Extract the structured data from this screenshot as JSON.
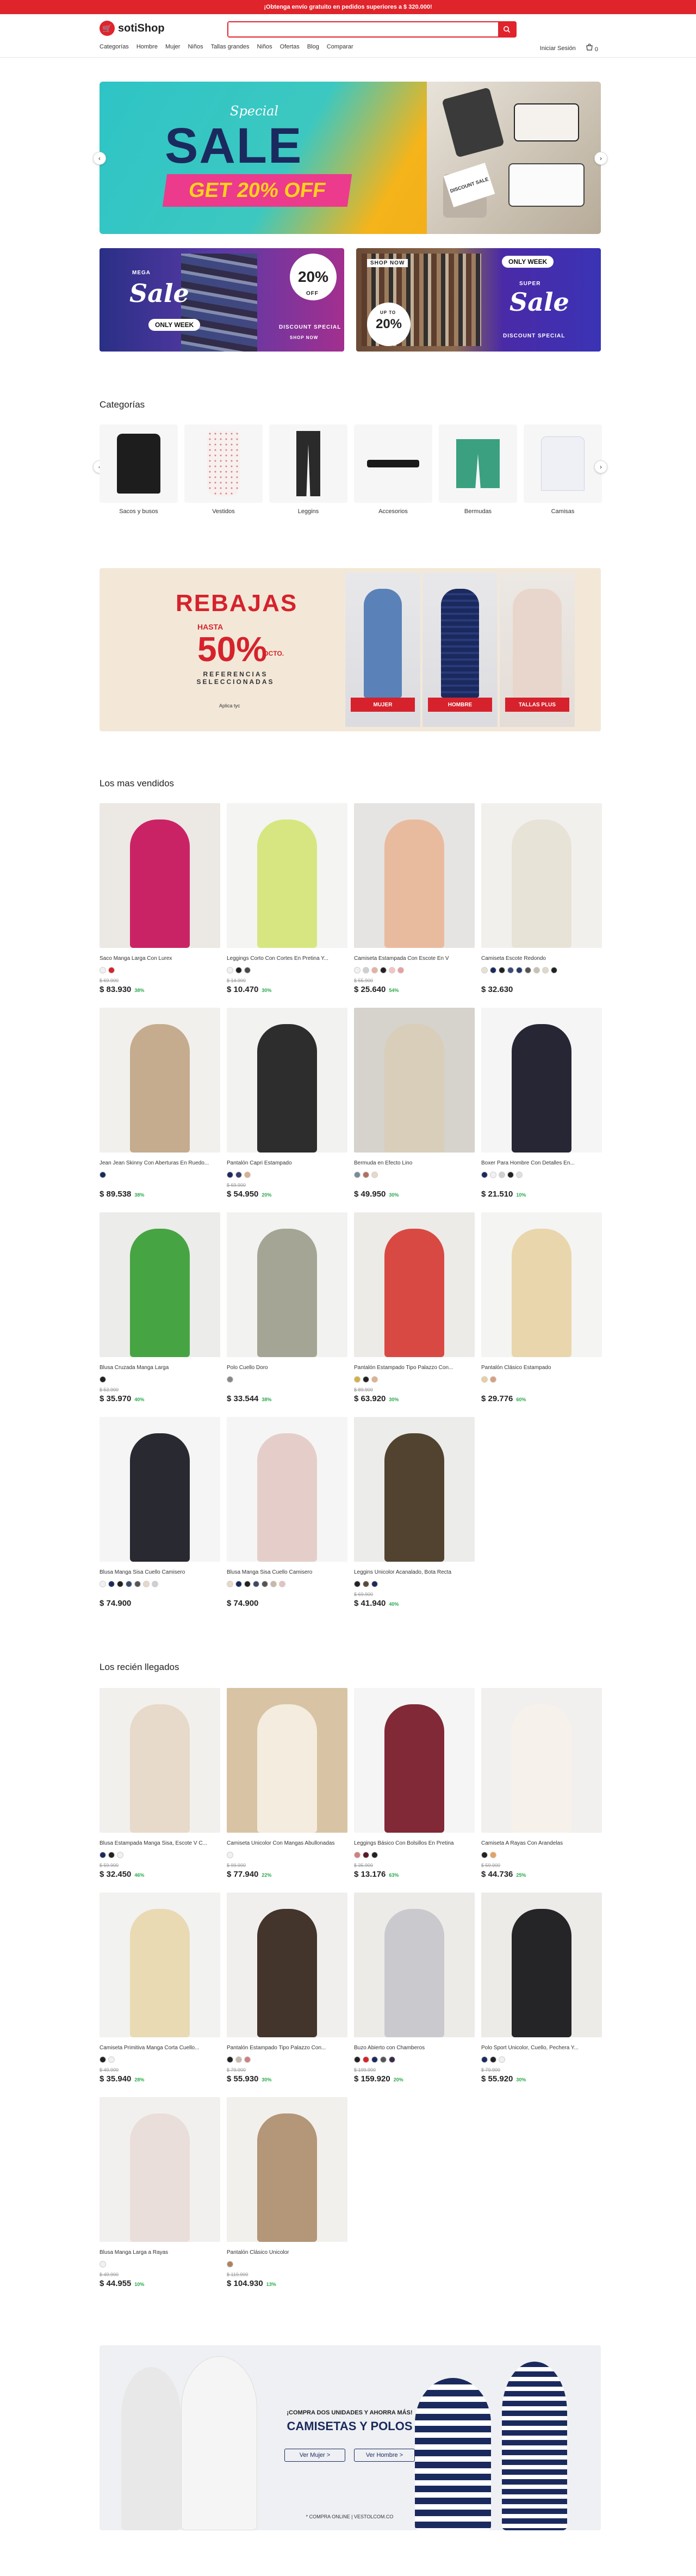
{
  "topbar": {
    "text": "¡Obtenga envío gratuito en pedidos superiores a $ 320.000!"
  },
  "header": {
    "logo_text": "sotiShop",
    "search_placeholder": "",
    "nav": [
      "Categorías",
      "Hombre",
      "Mujer",
      "Niños",
      "Tallas grandes",
      "Niños",
      "Ofertas",
      "Blog",
      "Comparar"
    ],
    "user_label": "Iniciar Sesión",
    "cart_count": "0"
  },
  "hero": {
    "special": "Special",
    "sale": "SALE",
    "offer": "GET 20% OFF",
    "tag": "DISCOUNT SALE"
  },
  "promos": {
    "left": {
      "mega": "MEGA",
      "sale": "Sale",
      "only_week": "ONLY WEEK",
      "pct": "20%",
      "off": "OFF",
      "discount": "DISCOUNT SPECIAL",
      "shop": "SHOP NOW"
    },
    "right": {
      "shop": "SHOP NOW",
      "upto": "UP TO",
      "pct": "20%",
      "only_week": "ONLY WEEK",
      "super": "SUPER",
      "sale": "Sale",
      "discount": "DISCOUNT SPECIAL"
    }
  },
  "categories": {
    "title": "Categorías",
    "items": [
      {
        "label": "Sacos y busos"
      },
      {
        "label": "Vestidos"
      },
      {
        "label": "Leggins"
      },
      {
        "label": "Accesorios"
      },
      {
        "label": "Bermudas"
      },
      {
        "label": "Camisas"
      }
    ]
  },
  "rebajas": {
    "title": "REBAJAS",
    "hasta": "HASTA",
    "pct": "50%",
    "dcto": "DCTO.",
    "ref": "REFERENCIAS SELECCIONADAS",
    "aplica": "Aplica tyc",
    "buttons": [
      "MUJER",
      "HOMBRE",
      "TALLAS PLUS"
    ]
  },
  "bestsellers": {
    "title": "Los mas vendidos",
    "products": [
      {
        "name": "Saco Manga Larga Con Lurex",
        "old": "$ 69.900",
        "price": "$ 83.930",
        "disc": "38%",
        "swatches": [
          "#f1f1f1",
          "#d6222c"
        ],
        "bg": "#ece8e4",
        "fig": "#c8185e"
      },
      {
        "name": "Leggings Corto Con Cortes En Pretina Y...",
        "old": "$ 14.900",
        "price": "$ 10.470",
        "disc": "30%",
        "swatches": [
          "#f1f1f1",
          "#222222",
          "#4a4a4a"
        ],
        "bg": "#f4f4f2",
        "fig": "#d5e57a"
      },
      {
        "name": "Camiseta Estampada Con Escote En V",
        "old": "$ 55.900",
        "price": "$ 25.640",
        "disc": "54%",
        "swatches": [
          "#f1f1f1",
          "#cfcfcf",
          "#e8b0a0",
          "#222222",
          "#f5c4c0",
          "#e8a0a0"
        ],
        "bg": "#e6e4e2",
        "fig": "#e9b89a"
      },
      {
        "name": "Camiseta Escote Redondo",
        "old": "",
        "price": "$ 32.630",
        "disc": "",
        "swatches": [
          "#e8e0d0",
          "#1b2a5e",
          "#222222",
          "#3a4a7a",
          "#2a3a6a",
          "#555555",
          "#c8c0b0",
          "#e0d8c8",
          "#222222"
        ],
        "bg": "#f2f0ed",
        "fig": "#e7e1d6"
      },
      {
        "name": "Jean Jean Skinny Con Aberturas En Ruedo...",
        "old": "",
        "price": "$ 89.538",
        "disc": "38%",
        "swatches": [
          "#1b2a5e"
        ],
        "bg": "#f2f0ec",
        "fig": "#c2a88a"
      },
      {
        "name": "Pantalón Capri Estampado",
        "old": "$ 69.900",
        "price": "$ 54.950",
        "disc": "20%",
        "swatches": [
          "#1b2a5e",
          "#3a3a6a",
          "#d6b090"
        ],
        "bg": "#f2f2f0",
        "fig": "#222222"
      },
      {
        "name": "Bermuda en Efecto Lino",
        "old": "",
        "price": "$ 49.950",
        "disc": "30%",
        "swatches": [
          "#7a8a9a",
          "#b07060",
          "#e8d8c8"
        ],
        "bg": "#d6d2cc",
        "fig": "#d8cdb8"
      },
      {
        "name": "Boxer Para Hombre Con Detalles En...",
        "old": "",
        "price": "$ 21.510",
        "disc": "10%",
        "swatches": [
          "#1b2a5e",
          "#f1f1f1",
          "#cfcfcf",
          "#222222",
          "#e0e0e0"
        ],
        "bg": "#f5f5f5",
        "fig": "#1a1a2a"
      },
      {
        "name": "Blusa Cruzada Manga Larga",
        "old": "$ 53.900",
        "price": "$ 35.970",
        "disc": "40%",
        "swatches": [
          "#222222"
        ],
        "bg": "#ececea",
        "fig": "#3ea03a"
      },
      {
        "name": "Polo Cuello Doro",
        "old": "",
        "price": "$ 33.544",
        "disc": "38%",
        "swatches": [
          "#888888"
        ],
        "bg": "#f2f2f0",
        "fig": "#a0a090"
      },
      {
        "name": "Pantalón Estampado Tipo Palazzo Con...",
        "old": "$ 89.900",
        "price": "$ 63.920",
        "disc": "30%",
        "swatches": [
          "#d6b040",
          "#222222",
          "#e0b090"
        ],
        "bg": "#ecebe8",
        "fig": "#d8403a"
      },
      {
        "name": "Pantalón Clásico Estampado",
        "old": "",
        "price": "$ 29.776",
        "disc": "60%",
        "swatches": [
          "#e8d0a0",
          "#d8a080"
        ],
        "bg": "#f4f4f2",
        "fig": "#e8d4a8"
      },
      {
        "name": "Blusa Manga Sisa Cuello Camisero",
        "old": "",
        "price": "$ 74.900",
        "disc": "",
        "swatches": [
          "#f1f1f1",
          "#1b2a5e",
          "#222222",
          "#3a4a6a",
          "#555555",
          "#e8d8c8",
          "#cfcfcf"
        ],
        "bg": "#f5f5f5",
        "fig": "#1d1d26"
      },
      {
        "name": "Blusa Manga Sisa Cuello Camisero",
        "old": "",
        "price": "$ 74.900",
        "disc": "",
        "swatches": [
          "#e8d8c8",
          "#1b2a5e",
          "#222222",
          "#3a4a6a",
          "#555555",
          "#c8b8a8",
          "#e8c0c0"
        ],
        "bg": "#f5f5f5",
        "fig": "#e4cbc6"
      },
      {
        "name": "Leggins Unicolor Acanalado, Bota Recta",
        "old": "$ 69.900",
        "price": "$ 41.940",
        "disc": "40%",
        "swatches": [
          "#222222",
          "#5a4a3a",
          "#1b2a5e"
        ],
        "bg": "#ececea",
        "fig": "#4a3a26"
      }
    ]
  },
  "arrivals": {
    "title": "Los recién llegados",
    "products": [
      {
        "name": "Blusa Estampada Manga Sisa, Escote V C...",
        "old": "$ 59.900",
        "price": "$ 32.450",
        "disc": "46%",
        "swatches": [
          "#1b2a5e",
          "#222222",
          "#f1f1f1"
        ],
        "bg": "#f2f0ec",
        "fig": "#e6d8c8"
      },
      {
        "name": "Camiseta Unicolor Con Mangas Abullonadas",
        "old": "$ 99.900",
        "price": "$ 77.940",
        "disc": "22%",
        "swatches": [
          "#f1f1f1"
        ],
        "bg": "#d8c4a4",
        "fig": "#f5eee2"
      },
      {
        "name": "Leggings Básico Con Bolsillos En Pretina",
        "old": "$ 35.900",
        "price": "$ 13.176",
        "disc": "63%",
        "swatches": [
          "#d08080",
          "#5a1a2a",
          "#222222"
        ],
        "bg": "#f5f5f5",
        "fig": "#7a1e2c"
      },
      {
        "name": "Camiseta A Rayas Con Arandelas",
        "old": "$ 59.900",
        "price": "$ 44.736",
        "disc": "25%",
        "swatches": [
          "#222222",
          "#e8a060"
        ],
        "bg": "#f2f0ee",
        "fig": "#f5f0ea"
      },
      {
        "name": "Camiseta Primitiva Manga Corta Cuello...",
        "old": "$ 49.900",
        "price": "$ 35.940",
        "disc": "28%",
        "swatches": [
          "#222222",
          "#f1f1f1"
        ],
        "bg": "#f2f2f0",
        "fig": "#e8d8b0"
      },
      {
        "name": "Pantalón Estampado Tipo Palazzo Con...",
        "old": "$ 79.900",
        "price": "$ 55.930",
        "disc": "30%",
        "swatches": [
          "#222222",
          "#c8b8a8",
          "#d08080"
        ],
        "bg": "#f0efed",
        "fig": "#3a2a22"
      },
      {
        "name": "Buzo Abierto con Chamberos",
        "old": "$ 199.900",
        "price": "$ 159.920",
        "disc": "20%",
        "swatches": [
          "#222222",
          "#d6222c",
          "#1b2a5e",
          "#555555",
          "#3a2a4a"
        ],
        "bg": "#ecebe8",
        "fig": "#c8c8cc"
      },
      {
        "name": "Polo Sport Unicolor, Cuello, Pechera Y...",
        "old": "$ 79.900",
        "price": "$ 55.920",
        "disc": "30%",
        "swatches": [
          "#1b2a5e",
          "#222222",
          "#f1f1f1"
        ],
        "bg": "#ecebe8",
        "fig": "#1a1a1e"
      },
      {
        "name": "Blusa Manga Larga a Rayas",
        "old": "$ 49.900",
        "price": "$ 44.955",
        "disc": "10%",
        "swatches": [
          "#f1f1f1"
        ],
        "bg": "#f2f0ee",
        "fig": "#e8dcd8"
      },
      {
        "name": "Pantalón Clásico Unicolor",
        "old": "$ 119.900",
        "price": "$ 104.930",
        "disc": "13%",
        "swatches": [
          "#b08060"
        ],
        "bg": "#f2f0ec",
        "fig": "#b09072"
      }
    ]
  },
  "bottom_banner": {
    "small": "¡COMPRA DOS UNIDADES Y AHORRA MÁS!",
    "big": "CAMISETAS Y POLOS",
    "btn_women": "Ver Mujer >",
    "btn_men": "Ver Hombre >",
    "foot": "* COMPRA ONLINE | VESTOLCOM.CO"
  }
}
